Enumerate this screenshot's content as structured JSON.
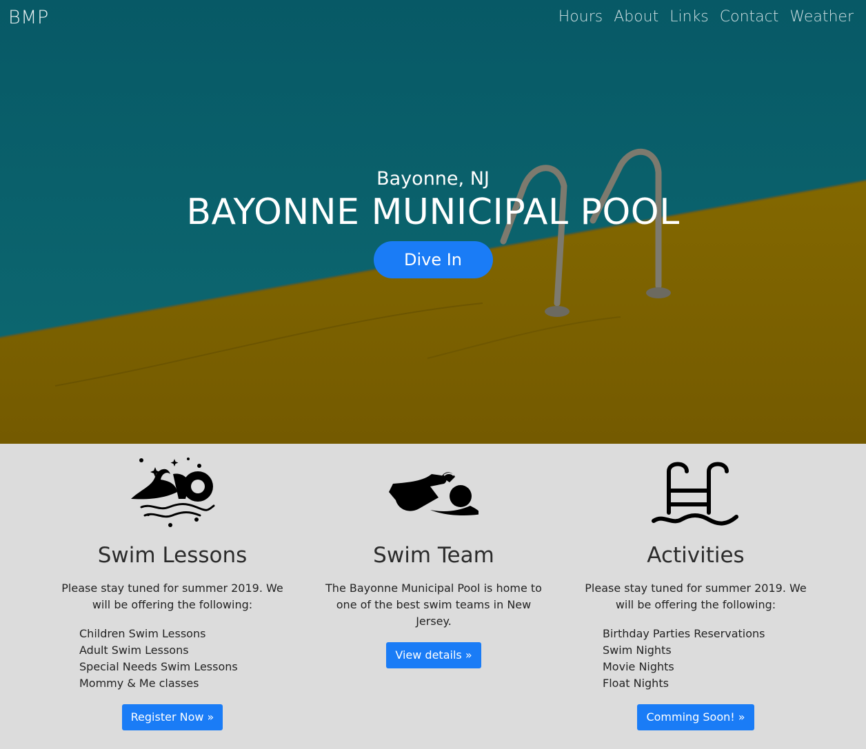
{
  "nav": {
    "brand": "BMP",
    "links": [
      "Hours",
      "About",
      "Links",
      "Contact",
      "Weather"
    ]
  },
  "hero": {
    "subtitle": "Bayonne, NJ",
    "title": "BAYONNE MUNICIPAL POOL",
    "cta_label": "Dive In"
  },
  "colors": {
    "water": "#0a5f6b",
    "deck": "#7a6200",
    "accent": "#1a7cf6",
    "section_bg": "#dcdcdc"
  },
  "features": [
    {
      "icon": "swimmer-splash-icon",
      "heading": "Swim Lessons",
      "text": "Please stay tuned for summer 2019. We will be offering the following:",
      "items": [
        "Children Swim Lessons",
        "Adult Swim Lessons",
        "Special Needs Swim Lessons",
        "Mommy & Me classes"
      ],
      "button": "Register Now »"
    },
    {
      "icon": "swimmer-icon",
      "heading": "Swim Team",
      "text": "The Bayonne Municipal Pool is home to one of the best swim teams in New Jersey.",
      "button": "View details »"
    },
    {
      "icon": "pool-ladder-icon",
      "heading": "Activities",
      "text": "Please stay tuned for summer 2019. We will be offering the following:",
      "items": [
        "Birthday Parties Reservations",
        "Swim Nights",
        "Movie Nights",
        "Float Nights"
      ],
      "button": "Comming Soon! »"
    }
  ]
}
